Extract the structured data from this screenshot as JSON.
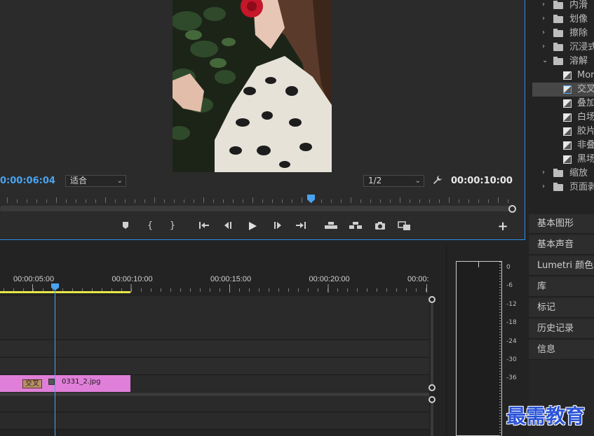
{
  "monitor": {
    "current_timecode": "0:00:06:04",
    "fit_dropdown": "适合",
    "resolution_dropdown": "1/2",
    "duration_timecode": "00:00:10:00",
    "transport_icons": [
      "marker-icon",
      "in-point-icon",
      "out-point-icon",
      "go-to-in-icon",
      "step-back-icon",
      "play-icon",
      "step-forward-icon",
      "go-to-out-icon",
      "lift-icon",
      "extract-icon",
      "export-frame-icon",
      "comparison-view-icon"
    ]
  },
  "effects_tree": {
    "items": [
      {
        "type": "folder",
        "label": "内滑",
        "expanded": false
      },
      {
        "type": "folder",
        "label": "划像",
        "expanded": false
      },
      {
        "type": "folder",
        "label": "擦除",
        "expanded": false
      },
      {
        "type": "folder",
        "label": "沉浸式",
        "expanded": false
      },
      {
        "type": "folder",
        "label": "溶解",
        "expanded": true
      },
      {
        "type": "effect",
        "label": "Morph"
      },
      {
        "type": "effect",
        "label": "交叉",
        "selected": true
      },
      {
        "type": "effect",
        "label": "叠加"
      },
      {
        "type": "effect",
        "label": "白场"
      },
      {
        "type": "effect",
        "label": "胶片"
      },
      {
        "type": "effect",
        "label": "非叠"
      },
      {
        "type": "effect",
        "label": "黑场"
      },
      {
        "type": "folder",
        "label": "缩放",
        "expanded": false
      },
      {
        "type": "folder",
        "label": "页面剥",
        "expanded": false
      }
    ]
  },
  "panel_stack": [
    "基本图形",
    "基本声音",
    "Lumetri 颜色",
    "库",
    "标记",
    "历史记录",
    "信息"
  ],
  "timeline": {
    "ruler_labels": [
      "00:00:05:00",
      "00:00:10:00",
      "00:00:15:00",
      "00:00:20:00",
      "00:00:"
    ],
    "clip_name": "0331_2.jpg",
    "transition_label": "交叉",
    "clip_color": "#e07fd9",
    "playhead_color": "#4aa3f0",
    "workarea_color": "#e6e64a"
  },
  "audio_meter": {
    "db_labels": [
      "0",
      "-6",
      "-12",
      "-18",
      "-24",
      "-30",
      "-36"
    ]
  },
  "watermark": "最需教育"
}
